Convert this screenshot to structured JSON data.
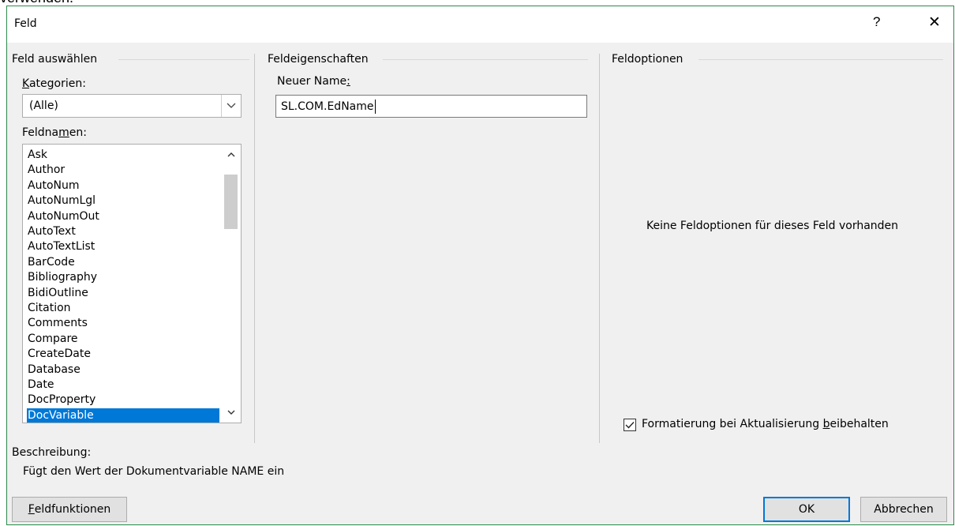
{
  "background_text": "verwenden.",
  "window": {
    "title": "Feld",
    "help_glyph": "?",
    "close_glyph": "✕"
  },
  "select_group": {
    "title": "Feld auswählen",
    "categories_label_mn": "K",
    "categories_label_rest": "ategorien:",
    "categories_value": "(Alle)",
    "fieldnames_label_pre": "Feldna",
    "fieldnames_label_mn": "m",
    "fieldnames_label_post": "en:",
    "fieldnames": [
      "Ask",
      "Author",
      "AutoNum",
      "AutoNumLgl",
      "AutoNumOut",
      "AutoText",
      "AutoTextList",
      "BarCode",
      "Bibliography",
      "BidiOutline",
      "Citation",
      "Comments",
      "Compare",
      "CreateDate",
      "Database",
      "Date",
      "DocProperty",
      "DocVariable"
    ],
    "selected_index": 17
  },
  "properties_group": {
    "title": "Feldeigenschaften",
    "name_label": "Neuer Name",
    "name_label_mn": ":",
    "name_value": "SL.COM.EdName"
  },
  "options_group": {
    "title": "Feldoptionen",
    "empty_message": "Keine Feldoptionen für dieses Feld vorhanden",
    "preserve_label_pre": "Formatierung bei Aktualisierung ",
    "preserve_label_mn": "b",
    "preserve_label_post": "eibehalten",
    "preserve_checked": true
  },
  "description": {
    "label": "Beschreibung:",
    "text": "Fügt den Wert der Dokumentvariable NAME ein"
  },
  "buttons": {
    "field_codes_mn": "F",
    "field_codes_rest": "eldfunktionen",
    "ok": "OK",
    "cancel": "Abbrechen"
  },
  "colors": {
    "selection": "#0078d7",
    "dialog_bg": "#f0f0f0",
    "border": "#2c8b4c"
  }
}
